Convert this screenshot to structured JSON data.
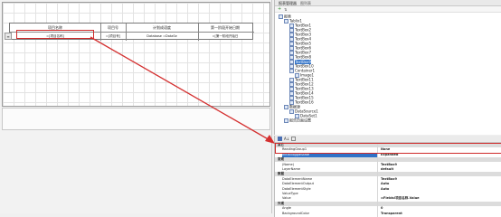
{
  "report": {
    "headers": [
      "项目名称",
      "项目号",
      "计划成语度",
      "第一阶段开始日期"
    ],
    "cells": [
      "=[项目名称]",
      "=[项目号]",
      "Database =DataSe",
      "=[第一阶段开始日"
    ]
  },
  "solution": {
    "tab1": "报表管理器",
    "tab2": "图列表",
    "tree": [
      {
        "label": "报表",
        "depth": 0
      },
      {
        "label": "Tablix1",
        "depth": 1
      },
      {
        "label": "TextBox1",
        "depth": 2
      },
      {
        "label": "TextBox2",
        "depth": 2
      },
      {
        "label": "TextBox3",
        "depth": 2
      },
      {
        "label": "TextBox4",
        "depth": 2
      },
      {
        "label": "TextBox5",
        "depth": 2
      },
      {
        "label": "TextBox6",
        "depth": 2
      },
      {
        "label": "TextBox7",
        "depth": 2
      },
      {
        "label": "TextBox8",
        "depth": 2
      },
      {
        "label": "TextBox9",
        "depth": 2,
        "selected": true
      },
      {
        "label": "TextBox10",
        "depth": 2
      },
      {
        "label": "Container1",
        "depth": 2
      },
      {
        "label": "Image1",
        "depth": 3
      },
      {
        "label": "TextBox11",
        "depth": 2
      },
      {
        "label": "TextBox12",
        "depth": 2
      },
      {
        "label": "TextBox13",
        "depth": 2
      },
      {
        "label": "TextBox14",
        "depth": 2
      },
      {
        "label": "TextBox15",
        "depth": 2
      },
      {
        "label": "TextBox16",
        "depth": 2
      },
      {
        "label": "数据源",
        "depth": 1
      },
      {
        "label": "DataSource1",
        "depth": 2
      },
      {
        "label": "DataSet1",
        "depth": 3
      },
      {
        "label": "报告页面设置",
        "depth": 1
      }
    ]
  },
  "properties": {
    "rows": [
      {
        "cat": "其它"
      },
      {
        "name": "ReadingGroup1",
        "value": "None"
      },
      {
        "name": "InitialToggleState",
        "value": "Expanded",
        "selected": true
      },
      {
        "cat": "常规"
      },
      {
        "name": "(Name)",
        "value": "TextBox9"
      },
      {
        "name": "LayerName",
        "value": "default"
      },
      {
        "cat": "数据"
      },
      {
        "name": "DataElementName",
        "value": "TextBox9"
      },
      {
        "name": "DataElementOutput",
        "value": "Auto"
      },
      {
        "name": "DataElementStyle",
        "value": "Auto"
      },
      {
        "name": "ValueType",
        "value": ""
      },
      {
        "name": "Value",
        "value": "=Fields!项目名称.Value"
      },
      {
        "cat": "外观"
      },
      {
        "name": "Angle",
        "value": "0"
      },
      {
        "name": "BackgroundColor",
        "value": "Transparent"
      }
    ]
  }
}
